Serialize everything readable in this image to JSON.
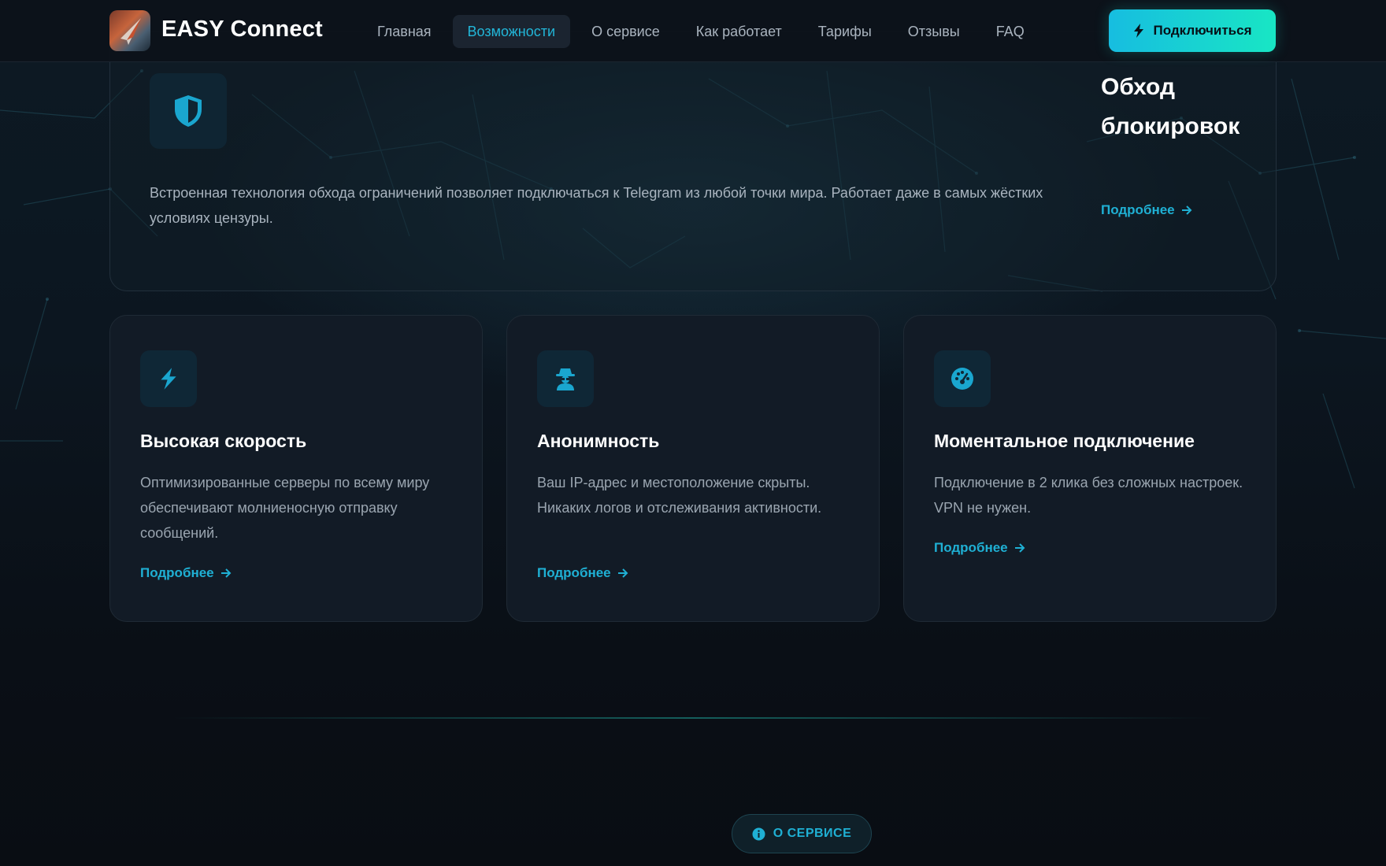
{
  "header": {
    "brand": "EASY Connect",
    "nav": [
      {
        "label": "Главная",
        "active": false
      },
      {
        "label": "Возможности",
        "active": true
      },
      {
        "label": "О сервисе",
        "active": false
      },
      {
        "label": "Как работает",
        "active": false
      },
      {
        "label": "Тарифы",
        "active": false
      },
      {
        "label": "Отзывы",
        "active": false
      },
      {
        "label": "FAQ",
        "active": false
      }
    ],
    "cta_label": "Подключиться",
    "cta_icon": "bolt-icon"
  },
  "hero_card": {
    "icon": "shield-icon",
    "text": "Встроенная технология обхода ограничений позволяет подключаться к Telegram из любой точки мира. Работает даже в самых жёстких условиях цензуры.",
    "title": "Обход блокировок",
    "more": "Подробнее"
  },
  "features": [
    {
      "icon": "bolt-icon",
      "title": "Высокая скорость",
      "text": "Оптимизированные серверы по всему миру обеспечивают молниеносную отправку сообщений.",
      "more": "Подробнее"
    },
    {
      "icon": "user-secret-icon",
      "title": "Анонимность",
      "text": "Ваш IP-адрес и местоположение скрыты. Никаких логов и отслеживания активности.",
      "more": "Подробнее"
    },
    {
      "icon": "gauge-icon",
      "title": "Моментальное подключение",
      "text": "Подключение в 2 клика без сложных настроек. VPN не нужен.",
      "more": "Подробнее"
    }
  ],
  "section_badge": {
    "icon": "info-icon",
    "label": "О СЕРВИСЕ"
  },
  "colors": {
    "accent": "#1fb0d4",
    "cta_gradient_start": "#17bde0",
    "cta_gradient_end": "#18e6c4",
    "background": "#0b1119",
    "card": "#121b26"
  }
}
